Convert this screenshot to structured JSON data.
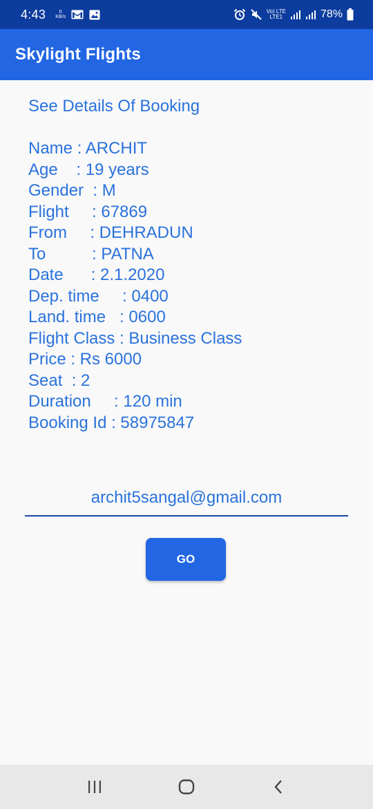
{
  "status_bar": {
    "time": "4:43",
    "net_speed_top": "0",
    "net_speed_bottom": "KB/s",
    "network_label_top": "Vo) LTE",
    "network_label_bottom": "LTE1",
    "battery": "78%",
    "icons": [
      "gmail-icon",
      "gallery-icon",
      "alarm-icon",
      "mute-icon",
      "signal-icon",
      "signal-icon",
      "battery-icon"
    ]
  },
  "app_bar": {
    "title": "Skylight Flights"
  },
  "heading": "See Details Of Booking",
  "details": [
    "Name : ARCHIT",
    "Age    : 19 years",
    "Gender  : M",
    "Flight     : 67869",
    "From     : DEHRADUN",
    "To          : PATNA",
    "Date      : 2.1.2020",
    "Dep. time     : 0400",
    "Land. time   : 0600",
    "Flight Class : Business Class",
    "Price : Rs 6000",
    "Seat  : 2",
    "Duration     : 120 min",
    "Booking Id : 58975847"
  ],
  "email": {
    "value": "archit5sangal@gmail.com"
  },
  "go_button": {
    "label": "GO"
  },
  "colors": {
    "status_bar": "#0c3c9e",
    "app_bar": "#2266e3",
    "text": "#2a72dd",
    "background": "#f9f9f9"
  }
}
